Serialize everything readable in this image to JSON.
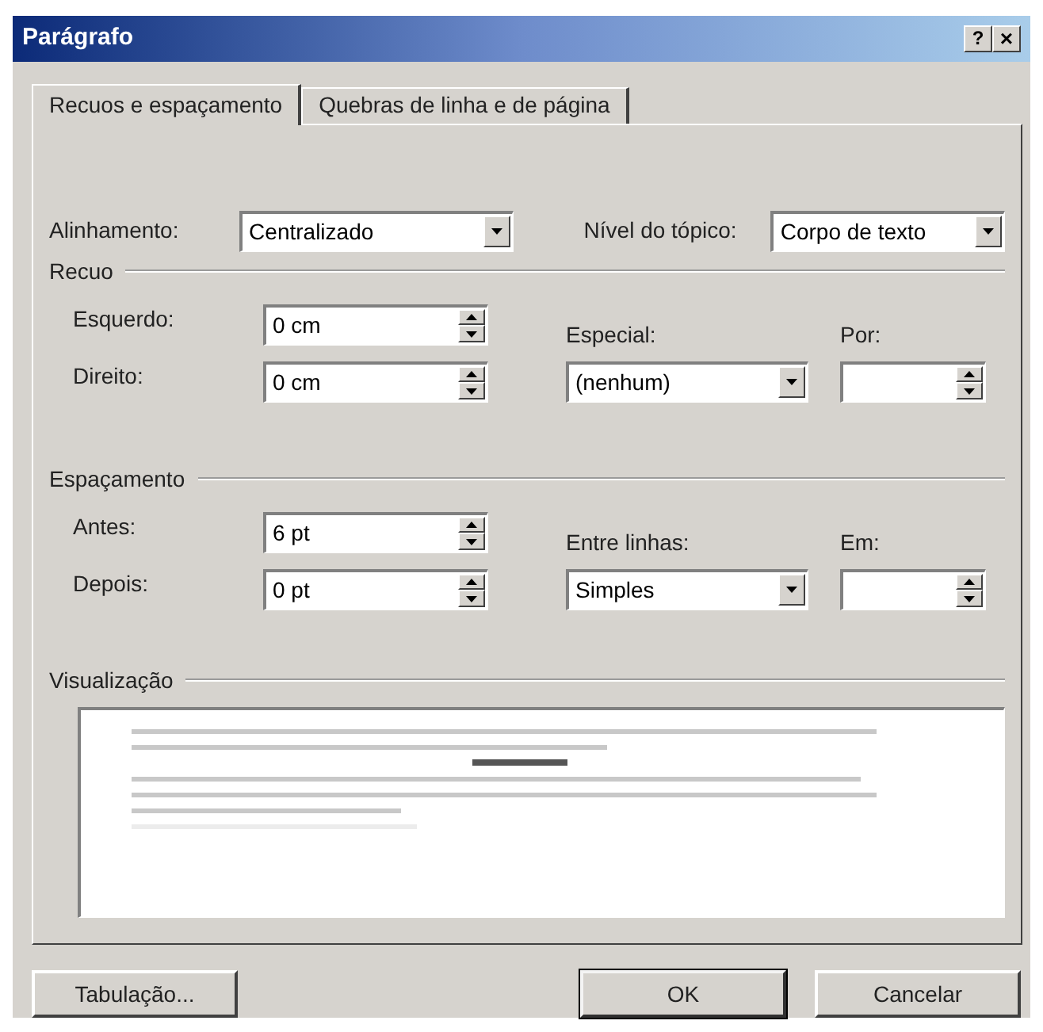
{
  "window": {
    "title": "Parágrafo",
    "help_button": "?",
    "close_button": "×"
  },
  "tabs": [
    {
      "label": "Recuos e espaçamento",
      "selected": true
    },
    {
      "label": "Quebras de linha e de página",
      "selected": false
    }
  ],
  "alignment": {
    "label": "Alinhamento:",
    "value": "Centralizado"
  },
  "outline_level": {
    "label": "Nível do tópico:",
    "value": "Corpo de texto"
  },
  "indent": {
    "heading": "Recuo",
    "left": {
      "label": "Esquerdo:",
      "value": "0 cm"
    },
    "right": {
      "label": "Direito:",
      "value": "0 cm"
    },
    "special": {
      "label": "Especial:",
      "value": "(nenhum)"
    },
    "by": {
      "label": "Por:"
    }
  },
  "spacing": {
    "heading": "Espaçamento",
    "before": {
      "label": "Antes:",
      "value": "6 pt"
    },
    "after": {
      "label": "Depois:",
      "value": "0 pt"
    },
    "line_spacing": {
      "label": "Entre linhas:",
      "value": "Simples"
    },
    "at": {
      "label": "Em:"
    }
  },
  "preview": {
    "heading": "Visualização"
  },
  "buttons": [
    {
      "label": "Tabulação...",
      "default": false
    },
    {
      "label": "OK",
      "default": true
    },
    {
      "label": "Cancelar",
      "default": false
    }
  ]
}
